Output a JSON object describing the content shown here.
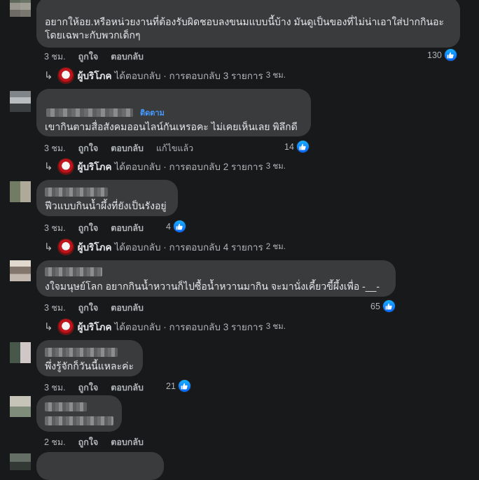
{
  "comments": [
    {
      "text": "อยากให้อย.หรือหน่วยงานที่ต้องรับผิดชอบลงขนมแบบนี้บ้าง มันดูเป็นของที่ไม่น่าเอาใส่ปากกินอะโดยเฉพาะกับพวกเด็กๆ",
      "time": "3 ชม.",
      "like_label": "ถูกใจ",
      "reply_label": "ตอบกลับ",
      "reactions": "130",
      "reply": {
        "author": "ผู้บริโภค",
        "action": "ได้ตอบกลับ · การตอบกลับ 3 รายการ",
        "time": "3 ชม."
      }
    },
    {
      "follow_label": "ติดตาม",
      "text": "เขากินตามสื่อสังคมออนไลน์กันเหรอคะ ไม่เคยเห็นเลย พิลึกดี",
      "time": "3 ชม.",
      "like_label": "ถูกใจ",
      "reply_label": "ตอบกลับ",
      "edited_label": "แก้ไขแล้ว",
      "reactions": "14",
      "reply": {
        "author": "ผู้บริโภค",
        "action": "ได้ตอบกลับ · การตอบกลับ 2 รายการ",
        "time": "3 ชม."
      }
    },
    {
      "text": "ฟีวแบบกินน้ำผึ้งที่ยังเป็นรังอยู่",
      "time": "3 ชม.",
      "like_label": "ถูกใจ",
      "reply_label": "ตอบกลับ",
      "reactions": "4",
      "reply": {
        "author": "ผู้บริโภค",
        "action": "ได้ตอบกลับ · การตอบกลับ 4 รายการ",
        "time": "2 ชม."
      }
    },
    {
      "text": "งใจมนุษย์โลก อยากกินน้ำหวานก็ไปซื้อน้ำหวานมากิน จะมานั่งเคี้ยวขี้ผึ้งเพื่อ -__-",
      "time": "3 ชม.",
      "like_label": "ถูกใจ",
      "reply_label": "ตอบกลับ",
      "reactions": "65",
      "reply": {
        "author": "ผู้บริโภค",
        "action": "ได้ตอบกลับ · การตอบกลับ 3 รายการ",
        "time": "3 ชม."
      }
    },
    {
      "text": "พึ่งรู้จักก็วันนี้แหละค่ะ",
      "time": "3 ชม.",
      "like_label": "ถูกใจ",
      "reply_label": "ตอบกลับ",
      "reactions": "21"
    },
    {
      "time": "2 ชม.",
      "like_label": "ถูกใจ",
      "reply_label": "ตอบกลับ"
    }
  ],
  "colors": {
    "background": "#18191a",
    "bubble": "#3a3b3c",
    "like_blue": "#0866ff",
    "link_blue": "#4599ff"
  },
  "icons": {
    "like": "thumbs-up-icon",
    "reply_arrow": "reply-arrow-icon"
  }
}
